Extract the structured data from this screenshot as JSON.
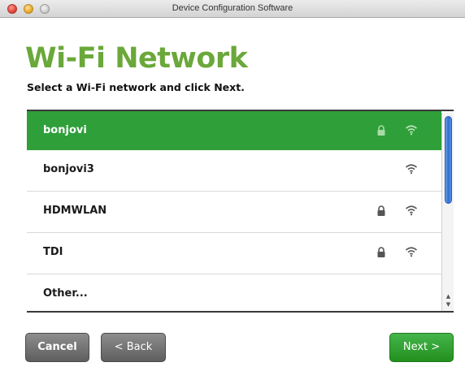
{
  "window": {
    "title": "Device Configuration Software"
  },
  "page": {
    "heading": "Wi-Fi Network",
    "subtitle": "Select a Wi-Fi network and click Next."
  },
  "networks": [
    {
      "name": "bonjovi",
      "secured": true,
      "selected": true,
      "lock_icon": "lock-icon",
      "signal_icon": "wifi-signal-icon"
    },
    {
      "name": "bonjovi3",
      "secured": false,
      "selected": false,
      "signal_icon": "wifi-signal-icon"
    },
    {
      "name": "HDMWLAN",
      "secured": true,
      "selected": false,
      "lock_icon": "lock-icon",
      "signal_icon": "wifi-signal-icon"
    },
    {
      "name": "TDI",
      "secured": true,
      "selected": false,
      "lock_icon": "lock-icon",
      "signal_icon": "wifi-signal-icon"
    },
    {
      "name": "Other...",
      "secured": false,
      "selected": false
    }
  ],
  "buttons": {
    "cancel": "Cancel",
    "back": "< Back",
    "next": "Next >"
  },
  "colors": {
    "heading": "#6aa83a",
    "selected_row": "#2f9f3a",
    "next_button": "#2f9f3a",
    "gray_button": "#707070"
  }
}
